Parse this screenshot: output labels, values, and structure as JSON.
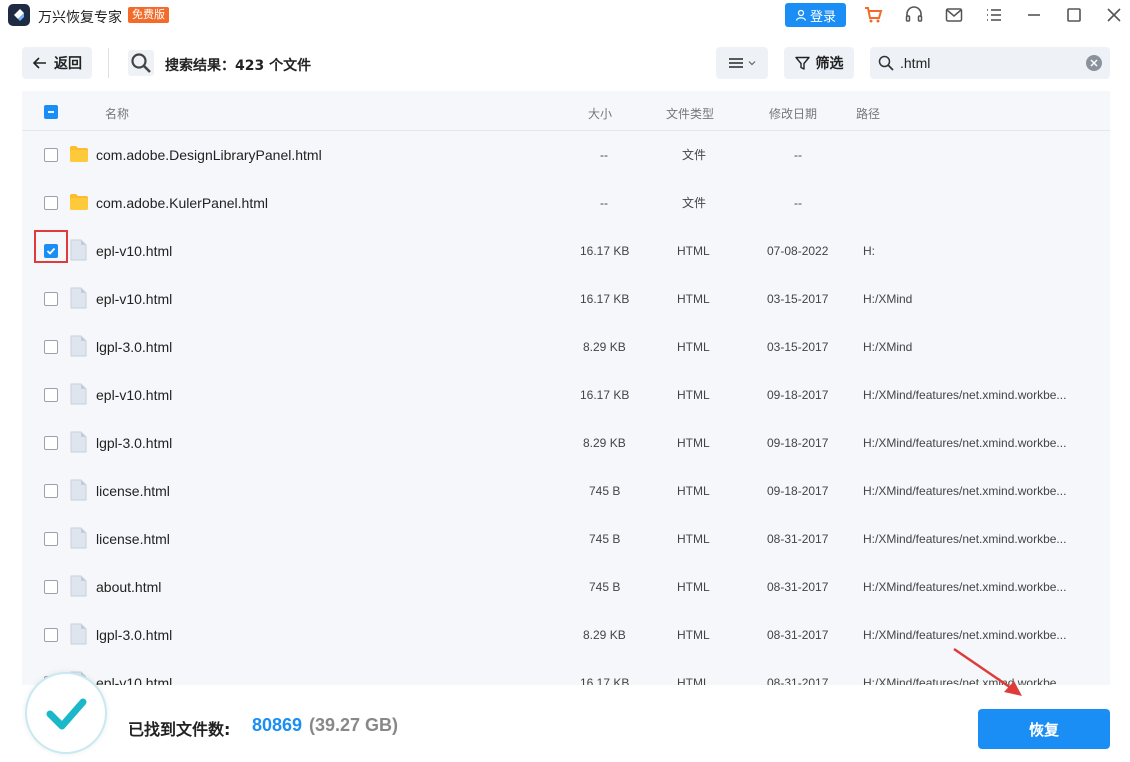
{
  "app": {
    "title": "万兴恢复专家",
    "badge": "免费版",
    "login_label": "登录"
  },
  "toolbar": {
    "back_label": "返回",
    "result_label": "搜索结果：423 个文件",
    "filter_label": "筛选",
    "search_value": ".html"
  },
  "table": {
    "headers": {
      "name": "名称",
      "size": "大小",
      "type": "文件类型",
      "date": "修改日期",
      "path": "路径"
    },
    "rows": [
      {
        "name": "com.adobe.DesignLibraryPanel.html",
        "size": "--",
        "type": "文件",
        "date": "--",
        "path": "",
        "icon": "folder",
        "checked": false
      },
      {
        "name": "com.adobe.KulerPanel.html",
        "size": "--",
        "type": "文件",
        "date": "--",
        "path": "",
        "icon": "folder",
        "checked": false
      },
      {
        "name": "epl-v10.html",
        "size": "16.17 KB",
        "type": "HTML",
        "date": "07-08-2022",
        "path": "H:",
        "icon": "file",
        "checked": true
      },
      {
        "name": "epl-v10.html",
        "size": "16.17 KB",
        "type": "HTML",
        "date": "03-15-2017",
        "path": "H:/XMind",
        "icon": "file",
        "checked": false
      },
      {
        "name": "lgpl-3.0.html",
        "size": "8.29 KB",
        "type": "HTML",
        "date": "03-15-2017",
        "path": "H:/XMind",
        "icon": "file",
        "checked": false
      },
      {
        "name": "epl-v10.html",
        "size": "16.17 KB",
        "type": "HTML",
        "date": "09-18-2017",
        "path": "H:/XMind/features/net.xmind.workbe...",
        "icon": "file",
        "checked": false
      },
      {
        "name": "lgpl-3.0.html",
        "size": "8.29 KB",
        "type": "HTML",
        "date": "09-18-2017",
        "path": "H:/XMind/features/net.xmind.workbe...",
        "icon": "file",
        "checked": false
      },
      {
        "name": "license.html",
        "size": "745 B",
        "type": "HTML",
        "date": "09-18-2017",
        "path": "H:/XMind/features/net.xmind.workbe...",
        "icon": "file",
        "checked": false
      },
      {
        "name": "license.html",
        "size": "745 B",
        "type": "HTML",
        "date": "08-31-2017",
        "path": "H:/XMind/features/net.xmind.workbe...",
        "icon": "file",
        "checked": false
      },
      {
        "name": "about.html",
        "size": "745 B",
        "type": "HTML",
        "date": "08-31-2017",
        "path": "H:/XMind/features/net.xmind.workbe...",
        "icon": "file",
        "checked": false
      },
      {
        "name": "lgpl-3.0.html",
        "size": "8.29 KB",
        "type": "HTML",
        "date": "08-31-2017",
        "path": "H:/XMind/features/net.xmind.workbe...",
        "icon": "file",
        "checked": false
      },
      {
        "name": "epl-v10.html",
        "size": "16.17 KB",
        "type": "HTML",
        "date": "08-31-2017",
        "path": "H:/XMind/features/net.xmind.workbe...",
        "icon": "file",
        "checked": false
      }
    ]
  },
  "footer": {
    "found_label": "已找到文件数:",
    "found_count": "80869",
    "found_size": "(39.27 GB)",
    "recover_label": "恢复"
  },
  "colors": {
    "accent": "#1a8ef5",
    "badge": "#f26b2a",
    "folder": "#fbbd2e",
    "highlight": "#e03b3b"
  }
}
